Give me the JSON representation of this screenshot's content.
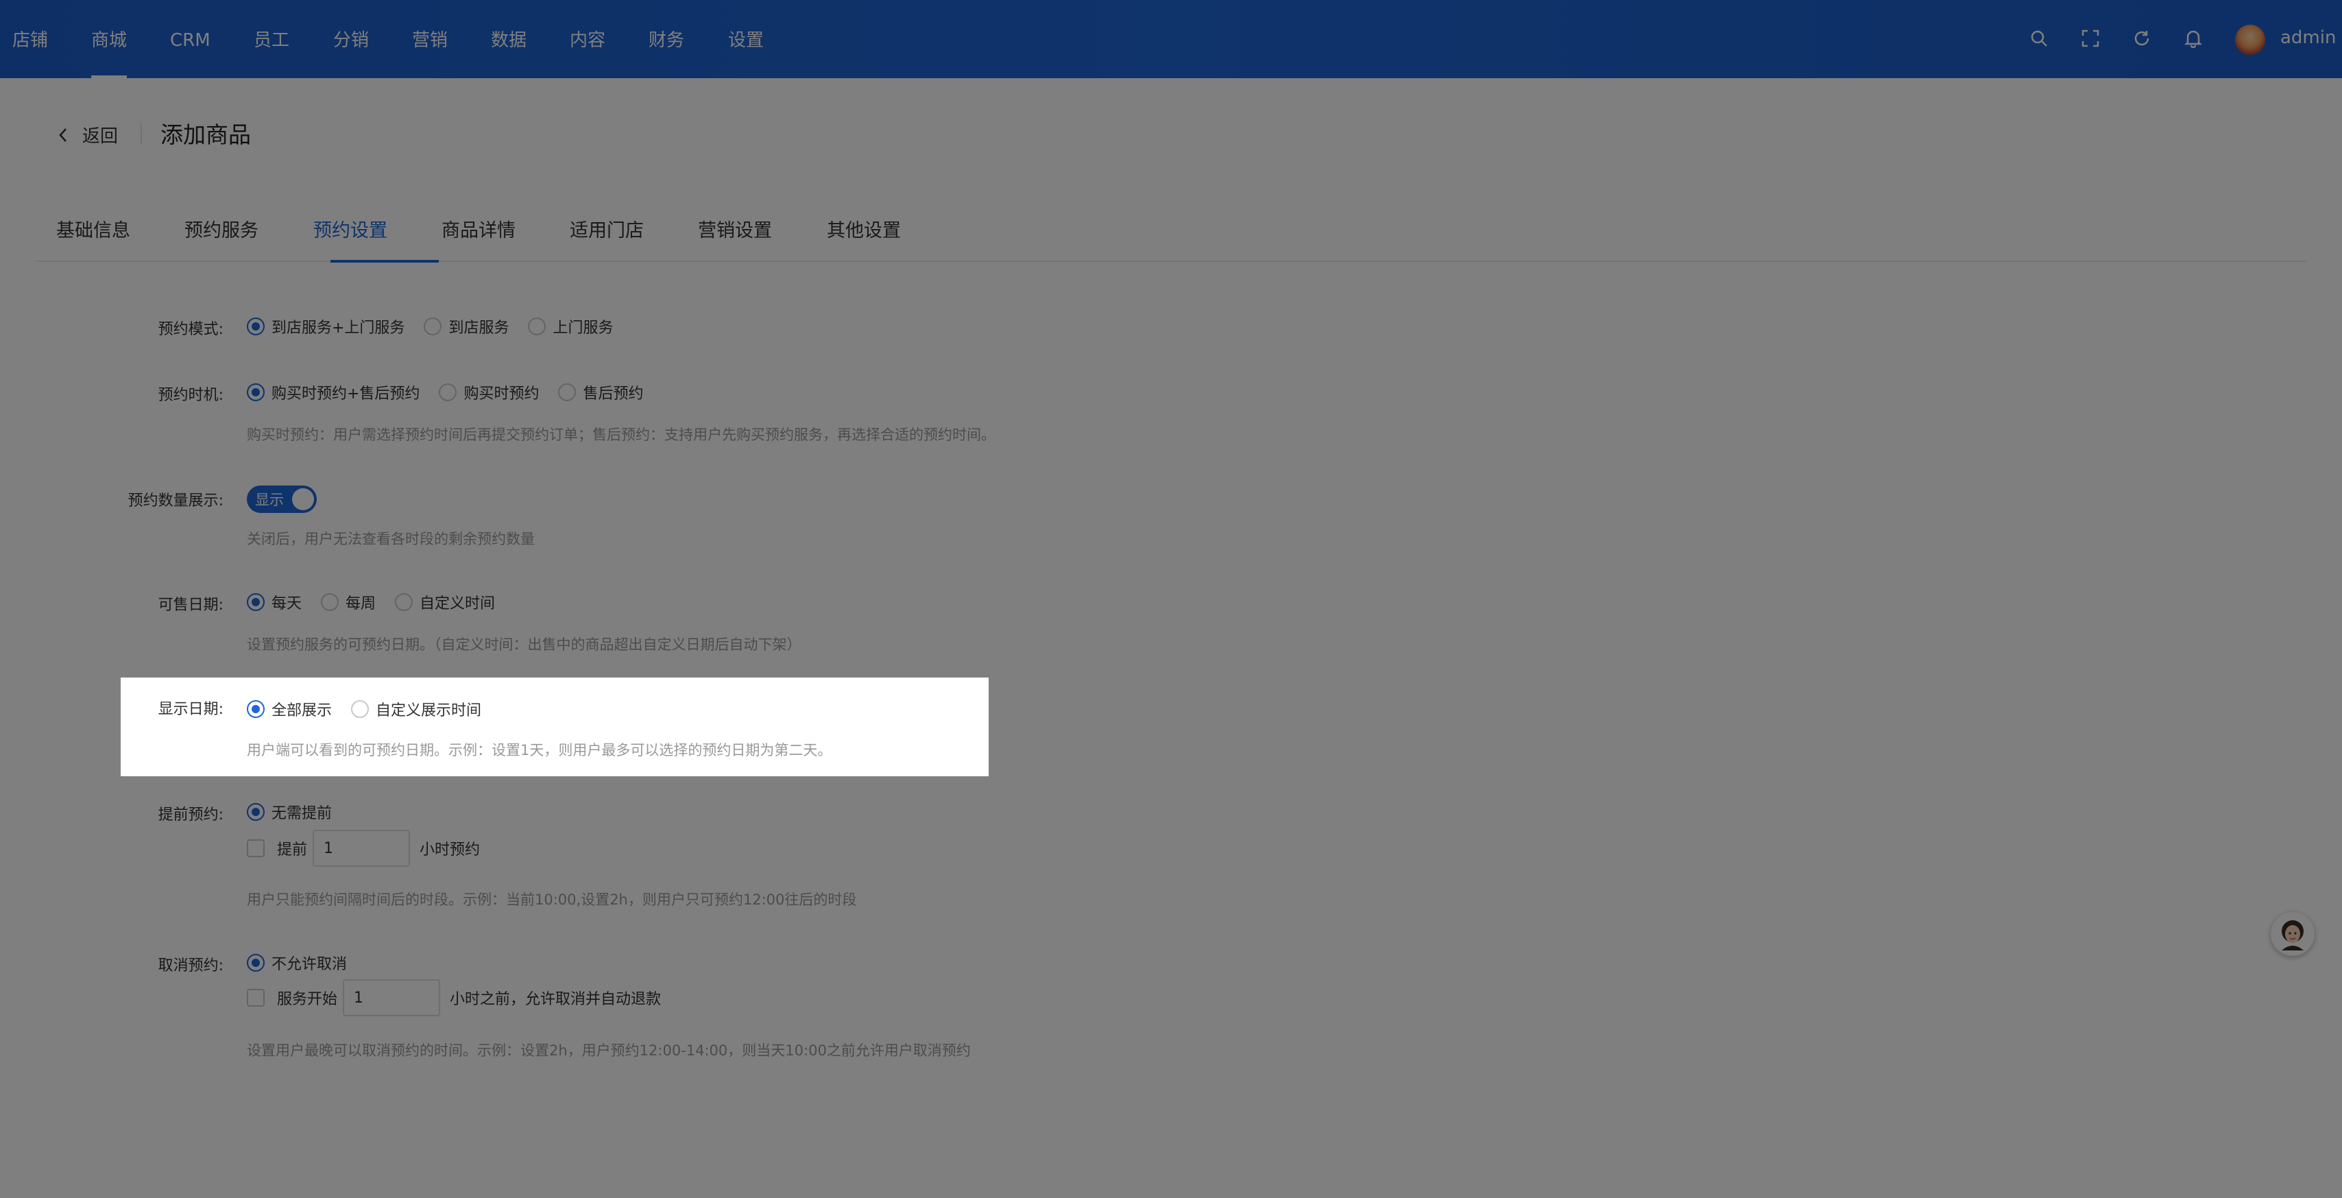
{
  "topnav": {
    "items": [
      "店铺",
      "商城",
      "CRM",
      "员工",
      "分销",
      "营销",
      "数据",
      "内容",
      "财务",
      "设置"
    ],
    "active_index": 1,
    "user_name": "admin"
  },
  "header": {
    "back_label": "返回",
    "page_title": "添加商品"
  },
  "tabs": {
    "items": [
      "基础信息",
      "预约服务",
      "预约设置",
      "商品详情",
      "适用门店",
      "营销设置",
      "其他设置"
    ],
    "active_index": 2
  },
  "form": {
    "booking_mode": {
      "label": "预约模式:",
      "options": [
        "到店服务+上门服务",
        "到店服务",
        "上门服务"
      ],
      "selected": 0
    },
    "booking_timing": {
      "label": "预约时机:",
      "options": [
        "购买时预约+售后预约",
        "购买时预约",
        "售后预约"
      ],
      "selected": 0,
      "help": "购买时预约：用户需选择预约时间后再提交预约订单；售后预约：支持用户先购买预约服务，再选择合适的预约时间。"
    },
    "quantity_display": {
      "label": "预约数量展示:",
      "switch_text": "显示",
      "enabled": true,
      "help": "关闭后，用户无法查看各时段的剩余预约数量"
    },
    "sale_date": {
      "label": "可售日期:",
      "options": [
        "每天",
        "每周",
        "自定义时间"
      ],
      "selected": 0,
      "help": "设置预约服务的可预约日期。（自定义时间：出售中的商品超出自定义日期后自动下架）"
    },
    "display_date": {
      "label": "显示日期:",
      "options": [
        "全部展示",
        "自定义展示时间"
      ],
      "selected": 0,
      "help": "用户端可以看到的可预约日期。示例：设置1天，则用户最多可以选择的预约日期为第二天。"
    },
    "advance_booking": {
      "label": "提前预约:",
      "option_none": "无需提前",
      "option_advance_prefix": "提前",
      "advance_value": "1",
      "option_advance_suffix": "小时预约",
      "help": "用户只能预约间隔时间后的时段。示例：当前10:00,设置2h，则用户只可预约12:00往后的时段"
    },
    "cancel_booking": {
      "label": "取消预约:",
      "option_none": "不允许取消",
      "option_prefix": "服务开始",
      "hours_value": "1",
      "option_suffix": "小时之前，允许取消并自动退款",
      "help": "设置用户最晚可以取消预约的时间。示例：设置2h，用户预约12:00-14:00，则当天10:00之前允许用户取消预约"
    }
  },
  "colors": {
    "primary": "#1f66d6",
    "overlay": "rgba(0,0,0,0.5)"
  }
}
